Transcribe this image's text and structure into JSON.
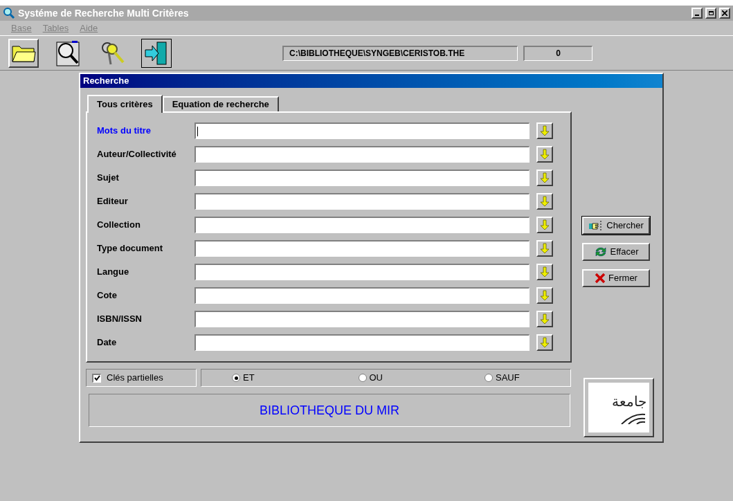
{
  "window": {
    "title": "Systéme de Recherche Multi Critères"
  },
  "menu": [
    "Base",
    "Tables",
    "Aide"
  ],
  "toolbar": {
    "path": "C:\\BIBLIOTHEQUE\\SYNGEB\\CERISTOB.THE",
    "count": "0"
  },
  "dialog": {
    "title": "Recherche",
    "tabs": [
      {
        "label": "Tous critères",
        "selected": true
      },
      {
        "label": "Equation de recherche",
        "selected": false
      }
    ],
    "fields": [
      {
        "label": "Mots du titre",
        "focused": true
      },
      {
        "label": "Auteur/Collectivité",
        "focused": false
      },
      {
        "label": "Sujet",
        "focused": false
      },
      {
        "label": "Editeur",
        "focused": false
      },
      {
        "label": "Collection",
        "focused": false
      },
      {
        "label": "Type document",
        "focused": false
      },
      {
        "label": "Langue",
        "focused": false
      },
      {
        "label": "Cote",
        "focused": false
      },
      {
        "label": "ISBN/ISSN",
        "focused": false
      },
      {
        "label": "Date",
        "focused": false
      }
    ],
    "buttons": [
      {
        "label": "Chercher",
        "kind": "search"
      },
      {
        "label": "Effacer",
        "kind": "refresh"
      },
      {
        "label": "Fermer",
        "kind": "close"
      }
    ],
    "partial_keys": {
      "label": "Clés partielles",
      "checked": true
    },
    "operators": [
      {
        "label": "ET",
        "selected": true
      },
      {
        "label": "OU",
        "selected": false
      },
      {
        "label": "SAUF",
        "selected": false
      }
    ],
    "banner": "BIBLIOTHEQUE DU MIR",
    "logo": {
      "text": "جامعة"
    }
  }
}
